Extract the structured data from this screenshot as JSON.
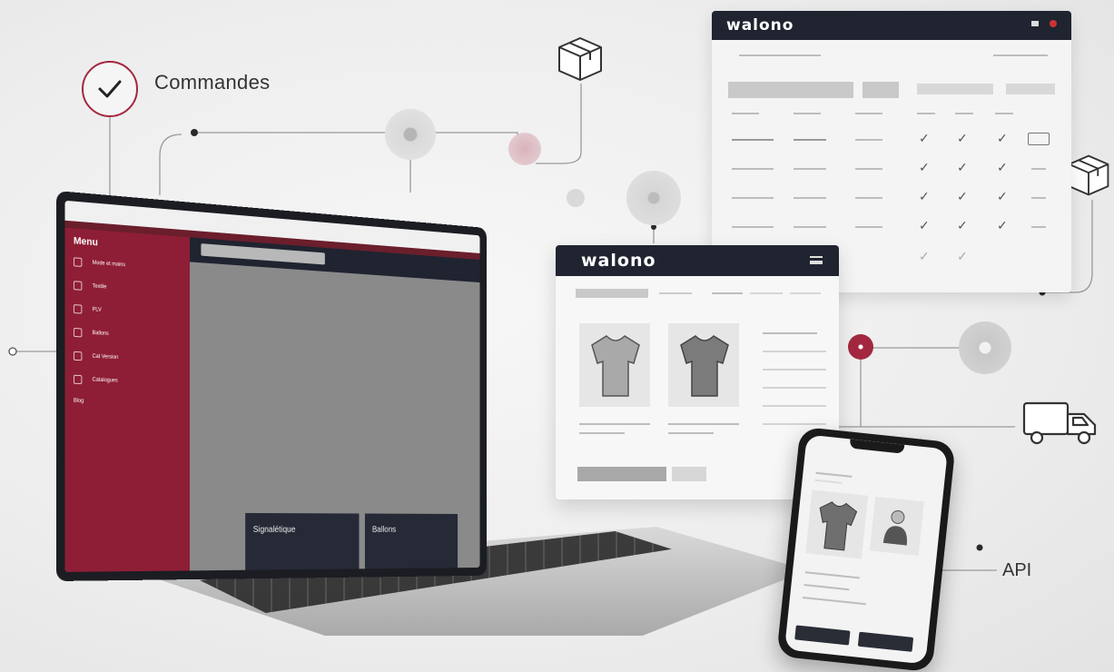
{
  "labels": {
    "commandes": "Commandes",
    "api": "API"
  },
  "brand": {
    "logo": "walono",
    "accent": "#8e1e35",
    "dark": "#1f2430"
  },
  "laptop": {
    "sidebar_title": "Menu",
    "sidebar_items": [
      "Mode et mains",
      "Textile",
      "PLV",
      "Ballons",
      "Cat Version",
      "Catalogues"
    ],
    "blog": "Blog",
    "tiles": [
      {
        "title": "Signalétique"
      },
      {
        "title": "Ballons"
      }
    ]
  },
  "icons": [
    "check-icon",
    "package-box-icon",
    "truck-icon"
  ]
}
